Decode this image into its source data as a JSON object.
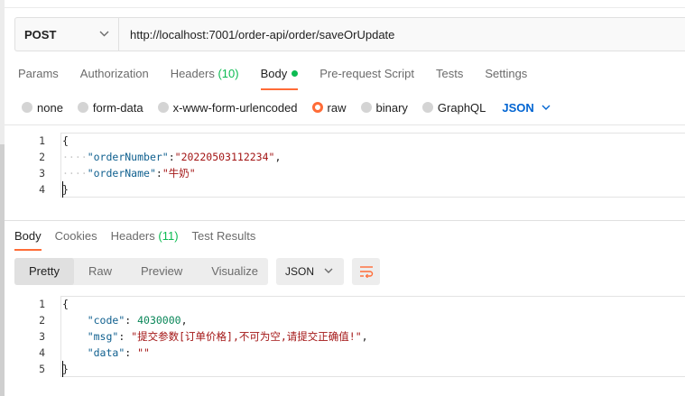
{
  "request": {
    "method": "POST",
    "url": "http://localhost:7001/order-api/order/saveOrUpdate"
  },
  "request_tabs": [
    {
      "label": "Params"
    },
    {
      "label": "Authorization"
    },
    {
      "label": "Headers",
      "count": "(10)"
    },
    {
      "label": "Body",
      "active": true
    },
    {
      "label": "Pre-request Script"
    },
    {
      "label": "Tests"
    },
    {
      "label": "Settings"
    }
  ],
  "body_types": {
    "options": [
      "none",
      "form-data",
      "x-www-form-urlencoded",
      "raw",
      "binary",
      "GraphQL"
    ],
    "selected": "raw",
    "language": "JSON"
  },
  "request_body": {
    "line_numbers": [
      "1",
      "2",
      "3",
      "4"
    ],
    "lines": {
      "l1": "{",
      "l2_key": "\"orderNumber\"",
      "l2_sep": ":",
      "l2_val": "\"20220503112234\"",
      "l2_end": ",",
      "l3_key": "\"orderName\"",
      "l3_sep": ":",
      "l3_val": "\"牛奶\"",
      "l4": "}"
    }
  },
  "response_tabs": [
    {
      "label": "Body",
      "active": true
    },
    {
      "label": "Cookies"
    },
    {
      "label": "Headers",
      "count": "(11)"
    },
    {
      "label": "Test Results"
    }
  ],
  "view_modes": {
    "options": [
      "Pretty",
      "Raw",
      "Preview",
      "Visualize"
    ],
    "selected": "Pretty",
    "format": "JSON"
  },
  "response_body": {
    "line_numbers": [
      "1",
      "2",
      "3",
      "4",
      "5"
    ],
    "lines": {
      "l1": "{",
      "l2_key": "\"code\"",
      "l2_sep": ": ",
      "l2_val": "4030000",
      "l2_end": ",",
      "l3_key": "\"msg\"",
      "l3_sep": ": ",
      "l3_val": "\"提交参数[订单价格],不可为空,请提交正确值!\"",
      "l3_end": ",",
      "l4_key": "\"data\"",
      "l4_sep": ": ",
      "l4_val": "\"\"",
      "l5": "}"
    }
  },
  "colors": {
    "accent": "#ff6c37",
    "success": "#0cbb52",
    "link": "#0265d2"
  }
}
